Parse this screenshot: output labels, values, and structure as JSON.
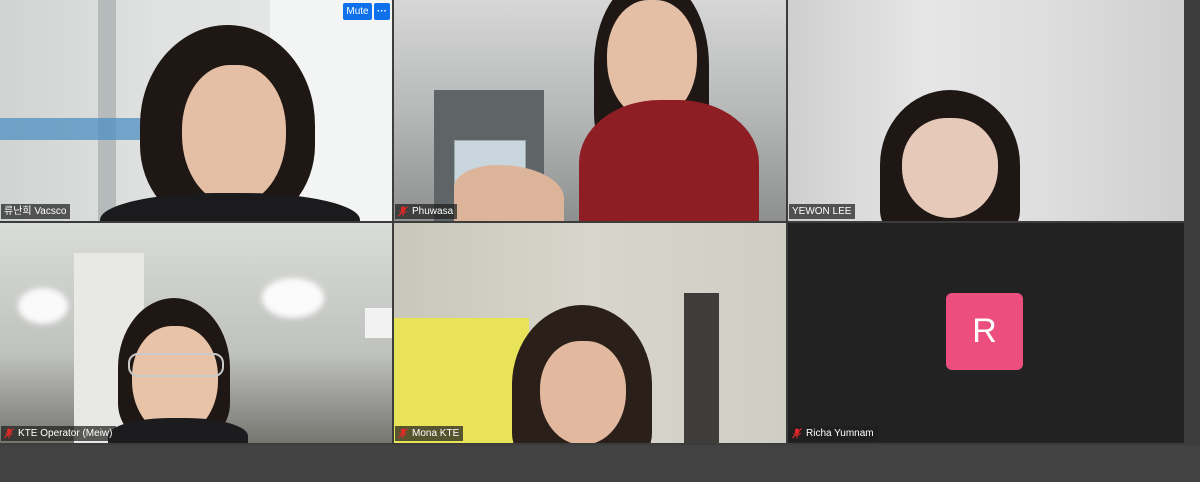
{
  "participants": [
    {
      "name": "류난희 Vacsco",
      "muted": false,
      "active_speaker": true,
      "video": true
    },
    {
      "name": "Phuwasa",
      "muted": true,
      "active_speaker": false,
      "video": true
    },
    {
      "name": "YEWON LEE",
      "muted": false,
      "active_speaker": false,
      "video": true
    },
    {
      "name": "KTE Operator (Meiw)",
      "muted": true,
      "active_speaker": false,
      "video": true
    },
    {
      "name": "Mona KTE",
      "muted": true,
      "active_speaker": false,
      "video": true
    },
    {
      "name": "Richa Yumnam",
      "muted": true,
      "active_speaker": false,
      "video": false,
      "avatar_letter": "R"
    }
  ],
  "controls": {
    "mute_label": "Mute",
    "more_label": "···"
  },
  "colors": {
    "active_border": "#23d959",
    "mute_button": "#0e71eb",
    "avatar_bg": "#ec4e7e",
    "muted_icon": "#e02828"
  }
}
